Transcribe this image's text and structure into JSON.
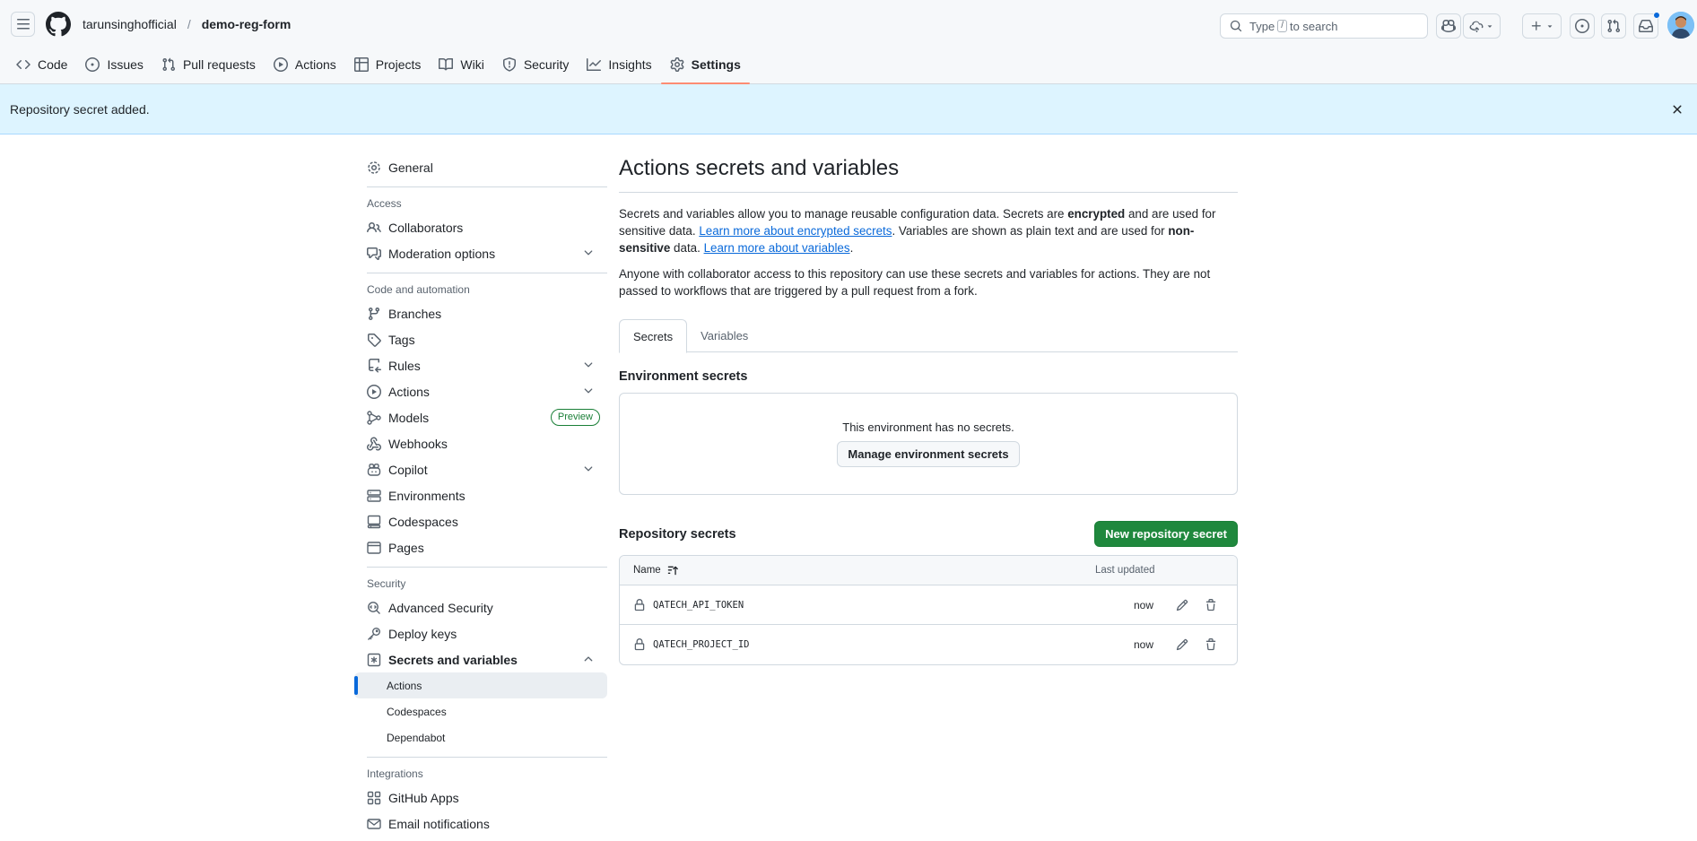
{
  "header": {
    "owner": "tarunsinghofficial",
    "separator": "/",
    "repo": "demo-reg-form",
    "search": {
      "prefix": "Type",
      "key": "/",
      "suffix": "to search"
    }
  },
  "repo_nav": [
    {
      "label": "Code",
      "icon": "code-icon"
    },
    {
      "label": "Issues",
      "icon": "issue-icon"
    },
    {
      "label": "Pull requests",
      "icon": "pull-request-icon"
    },
    {
      "label": "Actions",
      "icon": "play-icon"
    },
    {
      "label": "Projects",
      "icon": "table-icon"
    },
    {
      "label": "Wiki",
      "icon": "book-icon"
    },
    {
      "label": "Security",
      "icon": "shield-icon"
    },
    {
      "label": "Insights",
      "icon": "graph-icon"
    },
    {
      "label": "Settings",
      "icon": "gear-icon",
      "selected": true
    }
  ],
  "flash": {
    "message": "Repository secret added."
  },
  "sidebar": {
    "general": "General",
    "access_heading": "Access",
    "collaborators": "Collaborators",
    "moderation": "Moderation options",
    "code_heading": "Code and automation",
    "branches": "Branches",
    "tags": "Tags",
    "rules": "Rules",
    "actions": "Actions",
    "models": "Models",
    "models_badge": "Preview",
    "webhooks": "Webhooks",
    "copilot": "Copilot",
    "environments": "Environments",
    "codespaces": "Codespaces",
    "pages": "Pages",
    "security_heading": "Security",
    "advanced_security": "Advanced Security",
    "deploy_keys": "Deploy keys",
    "secrets_vars": "Secrets and variables",
    "sub_actions": "Actions",
    "sub_codespaces": "Codespaces",
    "sub_dependabot": "Dependabot",
    "integrations_heading": "Integrations",
    "github_apps": "GitHub Apps",
    "email_notifications": "Email notifications"
  },
  "main": {
    "title": "Actions secrets and variables",
    "desc": {
      "p1a": "Secrets and variables allow you to manage reusable configuration data. Secrets are ",
      "p1b": "encrypted",
      "p1c": " and are used for sensitive data. ",
      "link1": "Learn more about encrypted secrets",
      "p1d": ". Variables are shown as plain text and are used for ",
      "p1e": "non-sensitive",
      "p1f": " data. ",
      "link2": "Learn more about variables",
      "p1g": ".",
      "p2": "Anyone with collaborator access to this repository can use these secrets and variables for actions. They are not passed to workflows that are triggered by a pull request from a fork."
    },
    "tabs": {
      "secrets": "Secrets",
      "variables": "Variables"
    },
    "env": {
      "title": "Environment secrets",
      "empty": "This environment has no secrets.",
      "manage_button": "Manage environment secrets"
    },
    "repo": {
      "title": "Repository secrets",
      "new_button": "New repository secret",
      "col_name": "Name",
      "col_updated": "Last updated",
      "rows": [
        {
          "name": "QATECH_API_TOKEN",
          "updated": "now"
        },
        {
          "name": "QATECH_PROJECT_ID",
          "updated": "now"
        }
      ]
    }
  },
  "colors": {
    "accent": "#0969da",
    "primary_button": "#1f883d",
    "flash_bg": "#ddf4ff",
    "selected_underline": "#fd8c73"
  }
}
